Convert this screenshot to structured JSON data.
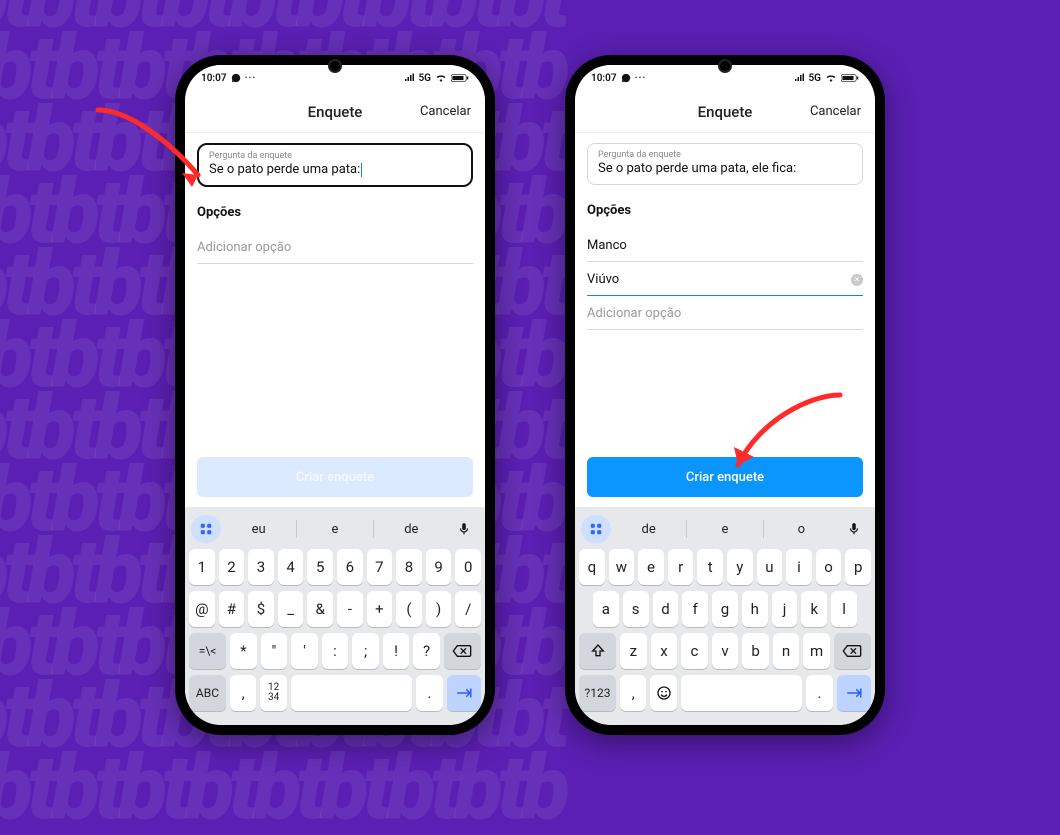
{
  "background_color": "#5B1FB3",
  "status": {
    "time": "10:07",
    "network": "5G"
  },
  "header": {
    "title": "Enquete",
    "cancel": "Cancelar"
  },
  "question": {
    "label": "Pergunta da enquete",
    "value_left": "Se o pato perde uma pata:",
    "value_right": "Se o pato perde uma pata, ele fica:"
  },
  "options": {
    "section": "Opções",
    "placeholder": "Adicionar opção",
    "right_values": [
      "Manco",
      "Viúvo"
    ]
  },
  "create_button": {
    "label": "Criar enquete"
  },
  "keyboard_left": {
    "suggestions": [
      "eu",
      "e",
      "de"
    ],
    "row1": [
      "1",
      "2",
      "3",
      "4",
      "5",
      "6",
      "7",
      "8",
      "9",
      "0"
    ],
    "row2": [
      "@",
      "#",
      "$",
      "_",
      "&",
      "-",
      "+",
      "(",
      ")",
      "/"
    ],
    "row3_left": "=\\<",
    "row3": [
      "*",
      "\"",
      "'",
      ":",
      ";",
      "!",
      "?"
    ],
    "row3_back": "⌫",
    "row4": {
      "abc": "ABC",
      "numfrac": "12\n34",
      "comma": ",",
      "space": "",
      "dot": ".",
      "enter": "→|"
    }
  },
  "keyboard_right": {
    "suggestions": [
      "de",
      "e",
      "o"
    ],
    "row1": [
      "q",
      "w",
      "e",
      "r",
      "t",
      "y",
      "u",
      "i",
      "o",
      "p"
    ],
    "row2": [
      "a",
      "s",
      "d",
      "f",
      "g",
      "h",
      "j",
      "k",
      "l"
    ],
    "row3_shift": "⇧",
    "row3": [
      "z",
      "x",
      "c",
      "v",
      "b",
      "n",
      "m"
    ],
    "row3_back": "⌫",
    "row4": {
      "nums": "?123",
      "comma": ",",
      "emoji": "☺",
      "space": "",
      "dot": ".",
      "enter": "→|"
    }
  }
}
